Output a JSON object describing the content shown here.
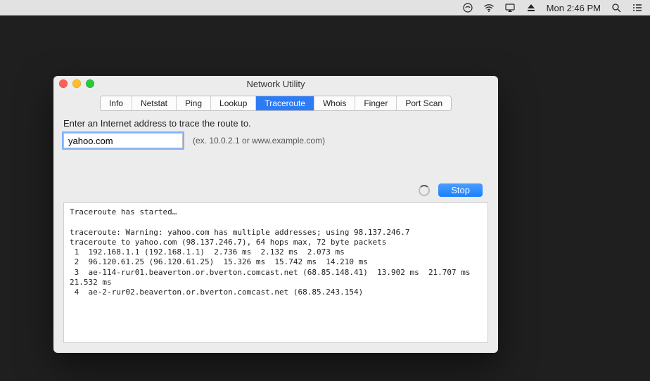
{
  "menubar": {
    "clock": "Mon 2:46 PM"
  },
  "window": {
    "title": "Network Utility"
  },
  "tabs": {
    "items": [
      {
        "label": "Info"
      },
      {
        "label": "Netstat"
      },
      {
        "label": "Ping"
      },
      {
        "label": "Lookup"
      },
      {
        "label": "Traceroute"
      },
      {
        "label": "Whois"
      },
      {
        "label": "Finger"
      },
      {
        "label": "Port Scan"
      }
    ],
    "active_index": 4
  },
  "form": {
    "prompt": "Enter an Internet address to trace the route to.",
    "value": "yahoo.com",
    "hint": "(ex. 10.0.2.1 or www.example.com)"
  },
  "action": {
    "button": "Stop"
  },
  "output": "Traceroute has started…\n\ntraceroute: Warning: yahoo.com has multiple addresses; using 98.137.246.7\ntraceroute to yahoo.com (98.137.246.7), 64 hops max, 72 byte packets\n 1  192.168.1.1 (192.168.1.1)  2.736 ms  2.132 ms  2.073 ms\n 2  96.120.61.25 (96.120.61.25)  15.326 ms  15.742 ms  14.210 ms\n 3  ae-114-rur01.beaverton.or.bverton.comcast.net (68.85.148.41)  13.902 ms  21.707 ms  21.532 ms\n 4  ae-2-rur02.beaverton.or.bverton.comcast.net (68.85.243.154)"
}
